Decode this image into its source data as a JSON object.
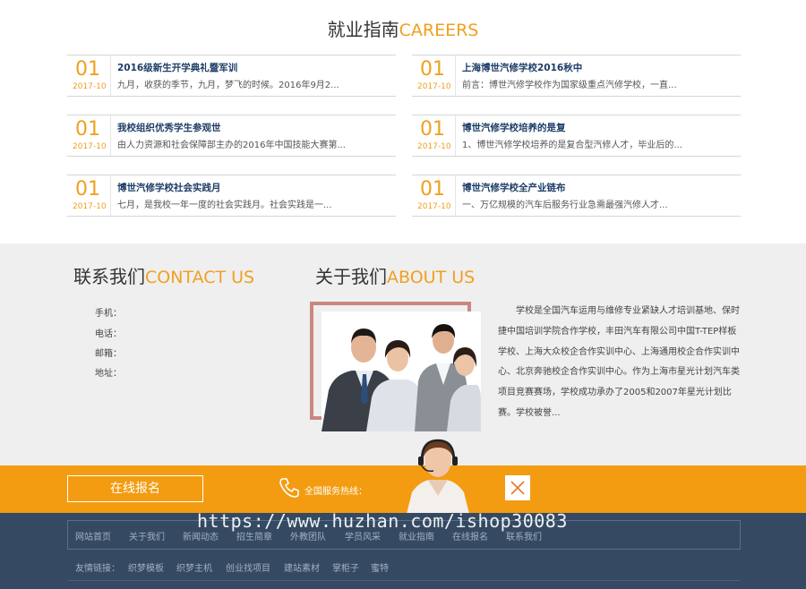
{
  "careers": {
    "title_cn": "就业指南",
    "title_en": "CAREERS",
    "items": [
      {
        "num": "01",
        "date": "2017-10",
        "title": "2016级新生开学典礼暨军训",
        "desc": "九月，收获的季节，九月，梦飞的时候。2016年9月2..."
      },
      {
        "num": "01",
        "date": "2017-10",
        "title": "上海博世汽修学校2016秋中",
        "desc": "前言：博世汽修学校作为国家级重点汽修学校，一直..."
      },
      {
        "num": "01",
        "date": "2017-10",
        "title": "我校组织优秀学生参观世",
        "desc": "由人力资源和社会保障部主办的2016年中国技能大赛第..."
      },
      {
        "num": "01",
        "date": "2017-10",
        "title": "博世汽修学校培养的是复",
        "desc": "1、博世汽修学校培养的是复合型汽修人才，毕业后的..."
      },
      {
        "num": "01",
        "date": "2017-10",
        "title": "博世汽修学校社会实践月",
        "desc": "七月，是我校一年一度的社会实践月。社会实践是一..."
      },
      {
        "num": "01",
        "date": "2017-10",
        "title": "博世汽修学校全产业链布",
        "desc": "一、万亿规模的汽车后服务行业急需最强汽修人才..."
      }
    ]
  },
  "contact": {
    "title_cn": "联系我们",
    "title_en": "CONTACT US",
    "phone_label": "手机：",
    "tel_label": "电话：",
    "email_label": "邮箱：",
    "address_label": "地址："
  },
  "about": {
    "title_cn": "关于我们",
    "title_en": "ABOUT US",
    "text": "学校是全国汽车运用与维修专业紧缺人才培训基地、保时捷中国培训学院合作学校，丰田汽车有限公司中国T-TEP样板学校、上海大众校企合作实训中心、上海通用校企合作实训中心、北京奔驰校企合作实训中心。作为上海市星光计划汽车类项目竞赛赛场，学校成功承办了2005和2007年星光计划比赛。学校被誉..."
  },
  "service_bar": {
    "signup_label": "在线报名",
    "hotline_label": "全国服务热线："
  },
  "footer": {
    "nav": [
      "网站首页",
      "关于我们",
      "新闻动态",
      "招生简章",
      "外教团队",
      "学员风采",
      "就业指南",
      "在线报名",
      "联系我们"
    ],
    "links_label": "友情链接：",
    "links": [
      "织梦模板",
      "织梦主机",
      "创业找项目",
      "建站素材",
      "掌柜子",
      "蜜特"
    ]
  },
  "watermark": "https://www.huzhan.com/ishop30083",
  "colors": {
    "accent": "#f39c12",
    "footer_bg": "#354a62",
    "title_orange": "#f0a020",
    "link_blue": "#1d3d66"
  }
}
